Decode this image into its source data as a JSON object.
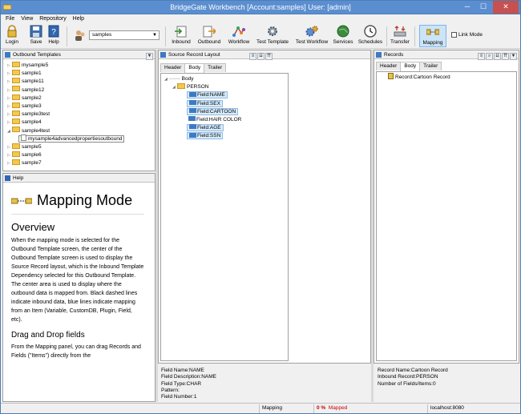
{
  "window": {
    "title": "BridgeGate Workbench [Account:samples] User: [admin]",
    "minimize": "─",
    "maximize": "☐",
    "close": "✕"
  },
  "menu": [
    "File",
    "View",
    "Repository",
    "Help"
  ],
  "toolbar": {
    "login": "Login",
    "save": "Save",
    "help": "Help",
    "account_value": "samples",
    "inbound": "Inbound",
    "outbound": "Outbound",
    "workflow": "Workflow",
    "test_template": "Test Template",
    "test_workflow": "Test Workflow",
    "services": "Services",
    "schedules": "Schedules",
    "transfer": "Transfer",
    "mapping": "Mapping",
    "link_mode": "Link Mode"
  },
  "outbound_templates": {
    "title": "Outbound Templates",
    "items": [
      {
        "label": "mysample5",
        "type": "folder",
        "expanded": false
      },
      {
        "label": "sample1",
        "type": "folder",
        "expanded": false
      },
      {
        "label": "sample11",
        "type": "folder",
        "expanded": false
      },
      {
        "label": "sample12",
        "type": "folder",
        "expanded": false
      },
      {
        "label": "sample2",
        "type": "folder",
        "expanded": false
      },
      {
        "label": "sample3",
        "type": "folder",
        "expanded": false
      },
      {
        "label": "sample3test",
        "type": "folder",
        "expanded": false
      },
      {
        "label": "sample4",
        "type": "folder",
        "expanded": false
      },
      {
        "label": "sample4test",
        "type": "folder",
        "expanded": true
      },
      {
        "label": "mysample4advancedpropertiesoutbound",
        "type": "doc",
        "child": true
      },
      {
        "label": "sample5",
        "type": "folder",
        "expanded": false
      },
      {
        "label": "sample6",
        "type": "folder",
        "expanded": false
      },
      {
        "label": "sample7",
        "type": "folder",
        "expanded": false
      }
    ]
  },
  "help_panel": {
    "title": "Help",
    "h1": "Mapping Mode",
    "h2": "Overview",
    "p1": "When the mapping mode is selected for the Outbound Template screen, the center of the Outbound Template screen is used to display the Source Record layout, which is the Inbound Template Dependency selected for this Outbound Template. The center area is used to display where the outbound data is mapped from. Black dashed lines indicate inbound data, blue lines indicate mapping from an Item (Variable, CustomDB, Plugin, Field, etc).",
    "h3": "Drag and Drop fields",
    "p2": "From the Mapping panel, you can drag Records and Fields (\"Items\") directly from the"
  },
  "source_layout": {
    "title": "Source Record Layout",
    "tabs": [
      "Header",
      "Body",
      "Trailer"
    ],
    "active_tab": "Body",
    "tree": {
      "root": "Body",
      "record": "PERSON",
      "fields": [
        {
          "label": "Field:NAME",
          "mapped": true
        },
        {
          "label": "Field:SEX",
          "mapped": true
        },
        {
          "label": "Field:CARTOON",
          "mapped": true
        },
        {
          "label": "Field:HAIR COLOR",
          "mapped": false
        },
        {
          "label": "Field:AGE",
          "mapped": true
        },
        {
          "label": "Field:SSN",
          "mapped": true
        }
      ]
    },
    "info": {
      "field_name": "Field Name:NAME",
      "field_description": "Field Description:NAME",
      "field_type": "Field Type:CHAR",
      "pattern": "Pattern:",
      "field_number": "Field Number:1"
    }
  },
  "records": {
    "title": "Records",
    "tabs": [
      "Header",
      "Body",
      "Trailer"
    ],
    "active_tab": "Body",
    "items": [
      "Record:Cartoon Record"
    ],
    "info": {
      "record_name": "Record Name:Cartoon Record",
      "inbound_record": "Inbound Record:PERSON",
      "count": "Number of Fields/Items:0"
    }
  },
  "status": {
    "mode": "Mapping",
    "percent": "0 %",
    "mapped": "Mapped",
    "server": "localhost:8080"
  },
  "colors": {
    "titlebar": "#5b8ed0",
    "accent": "#3d7ac4",
    "chip": "#d6ebfb",
    "status_red": "#cc0000"
  }
}
